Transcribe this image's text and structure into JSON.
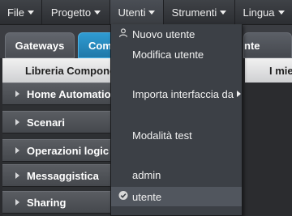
{
  "menubar": {
    "items": [
      {
        "label": "File"
      },
      {
        "label": "Progetto"
      },
      {
        "label": "Utenti"
      },
      {
        "label": "Strumenti"
      },
      {
        "label": "Lingua"
      }
    ]
  },
  "tabs": [
    {
      "label": "Gateways"
    },
    {
      "label": "Com"
    },
    {
      "label": "nte"
    }
  ],
  "left_panel": {
    "header": "Libreria Compone",
    "sections": [
      {
        "label": "Home Automatio"
      },
      {
        "label": "Scenari"
      },
      {
        "label": "Operazioni logic"
      },
      {
        "label": "Messaggistica"
      },
      {
        "label": "Sharing"
      }
    ]
  },
  "right_panel": {
    "header": "I mie"
  },
  "dropdown": {
    "items": [
      {
        "label": "Nuovo utente",
        "icon": "user-icon"
      },
      {
        "label": "Modifica utente"
      },
      {
        "label": "Importa interfaccia da",
        "submenu": true
      },
      {
        "label": "Modalità test"
      },
      {
        "label": "admin"
      },
      {
        "label": "utente",
        "icon": "check-icon",
        "selected": true
      }
    ]
  },
  "colors": {
    "accent_tab": "#2f9bd2",
    "menubar": "#3a3d42",
    "dropdown_bg": "#3c4046"
  }
}
